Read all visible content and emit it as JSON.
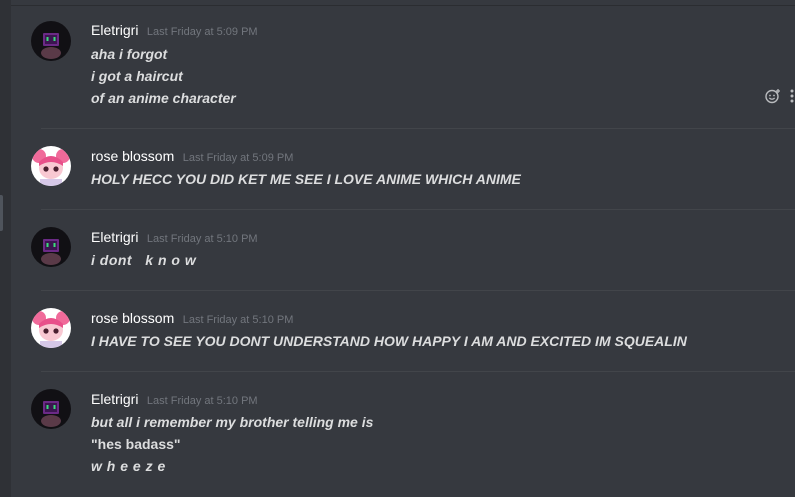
{
  "messages": [
    {
      "username": "Eletrigri",
      "timestamp": "Last Friday at 5:09 PM",
      "avatar": "eletrigri-avatar",
      "lines": [
        "aha i forgot",
        "i got a haircut",
        "of an anime character"
      ]
    },
    {
      "username": "rose blossom",
      "timestamp": "Last Friday at 5:09 PM",
      "avatar": "rose-avatar",
      "lines": [
        "HOLY HECC YOU DID KET ME SEE I LOVE ANIME WHICH ANIME"
      ]
    },
    {
      "username": "Eletrigri",
      "timestamp": "Last Friday at 5:10 PM",
      "avatar": "eletrigri-avatar",
      "lines": [
        "i dont   k n o w"
      ]
    },
    {
      "username": "rose blossom",
      "timestamp": "Last Friday at 5:10 PM",
      "avatar": "rose-avatar",
      "lines": [
        "I HAVE TO SEE YOU DONT UNDERSTAND HOW HAPPY I AM AND EXCITED IM SQUEALIN"
      ]
    },
    {
      "username": "Eletrigri",
      "timestamp": "Last Friday at 5:10 PM",
      "avatar": "eletrigri-avatar",
      "lines": [
        "but all i remember my brother telling me is",
        "\"hes badass\"",
        "w h e e z e"
      ]
    }
  ],
  "hover_actions": [
    "add-reaction-icon",
    "more-options-icon"
  ],
  "colors": {
    "background": "#36393f",
    "username": "#ffffff",
    "timestamp": "#72767d",
    "message_text": "#dcddde",
    "divider": "#42454a"
  }
}
